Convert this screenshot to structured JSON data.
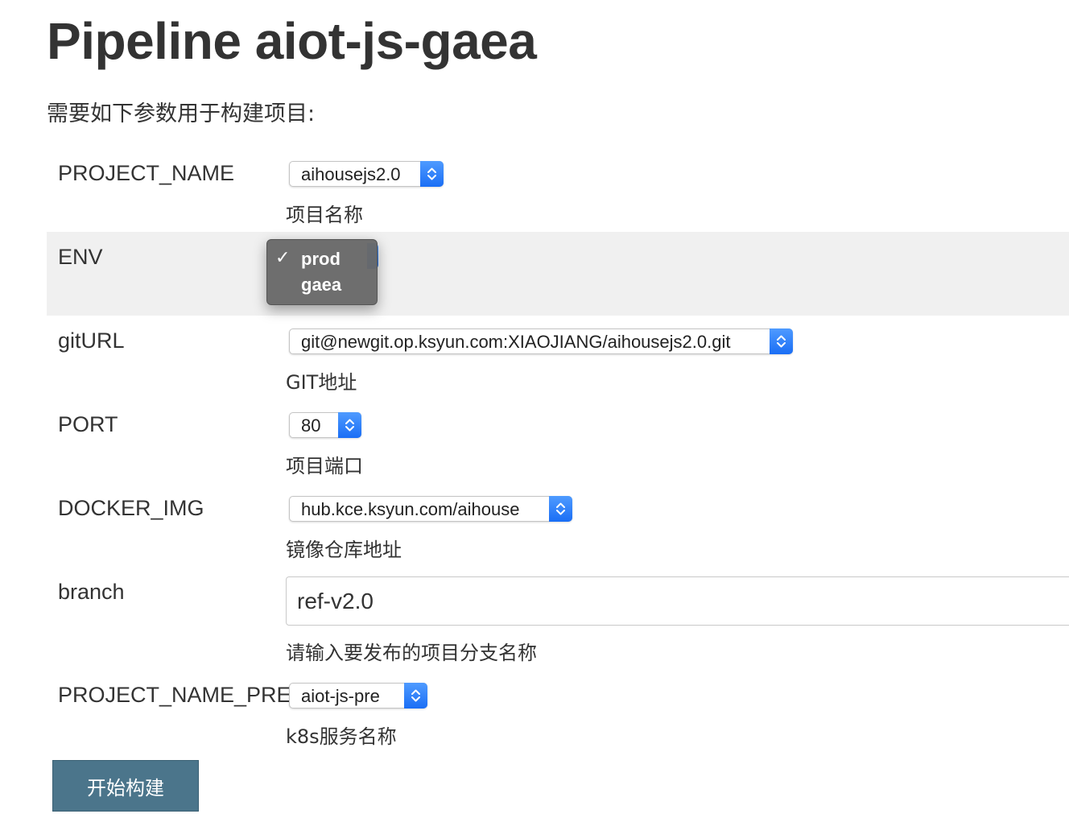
{
  "page": {
    "title": "Pipeline aiot-js-gaea",
    "intro": "需要如下参数用于构建项目:"
  },
  "params": {
    "project_name": {
      "name": "PROJECT_NAME",
      "value": "aihousejs2.0",
      "description": "项目名称"
    },
    "env": {
      "name": "ENV",
      "options": [
        "prod",
        "gaea"
      ],
      "selected": "prod",
      "check_mark": "✓"
    },
    "git_url": {
      "name": "gitURL",
      "value": "git@newgit.op.ksyun.com:XIAOJIANG/aihousejs2.0.git",
      "description": "GIT地址"
    },
    "port": {
      "name": "PORT",
      "value": "80",
      "description": "项目端口"
    },
    "docker_img": {
      "name": "DOCKER_IMG",
      "value": "hub.kce.ksyun.com/aihouse",
      "description": "镜像仓库地址"
    },
    "branch": {
      "name": "branch",
      "value": "ref-v2.0",
      "description": "请输入要发布的项目分支名称"
    },
    "project_name_pre": {
      "name": "PROJECT_NAME_PRE",
      "value": "aiot-js-pre",
      "description": "k8s服务名称"
    }
  },
  "build_button": {
    "label": "开始构建"
  },
  "colors": {
    "highlight_row": "#f0f0f0",
    "select_arrow": "#1a6ef5",
    "button_bg": "#4b758b",
    "dropdown_bg": "#686868"
  },
  "icons": {
    "select_arrow": "up-down-chevron-icon",
    "checkmark": "checkmark-icon"
  }
}
